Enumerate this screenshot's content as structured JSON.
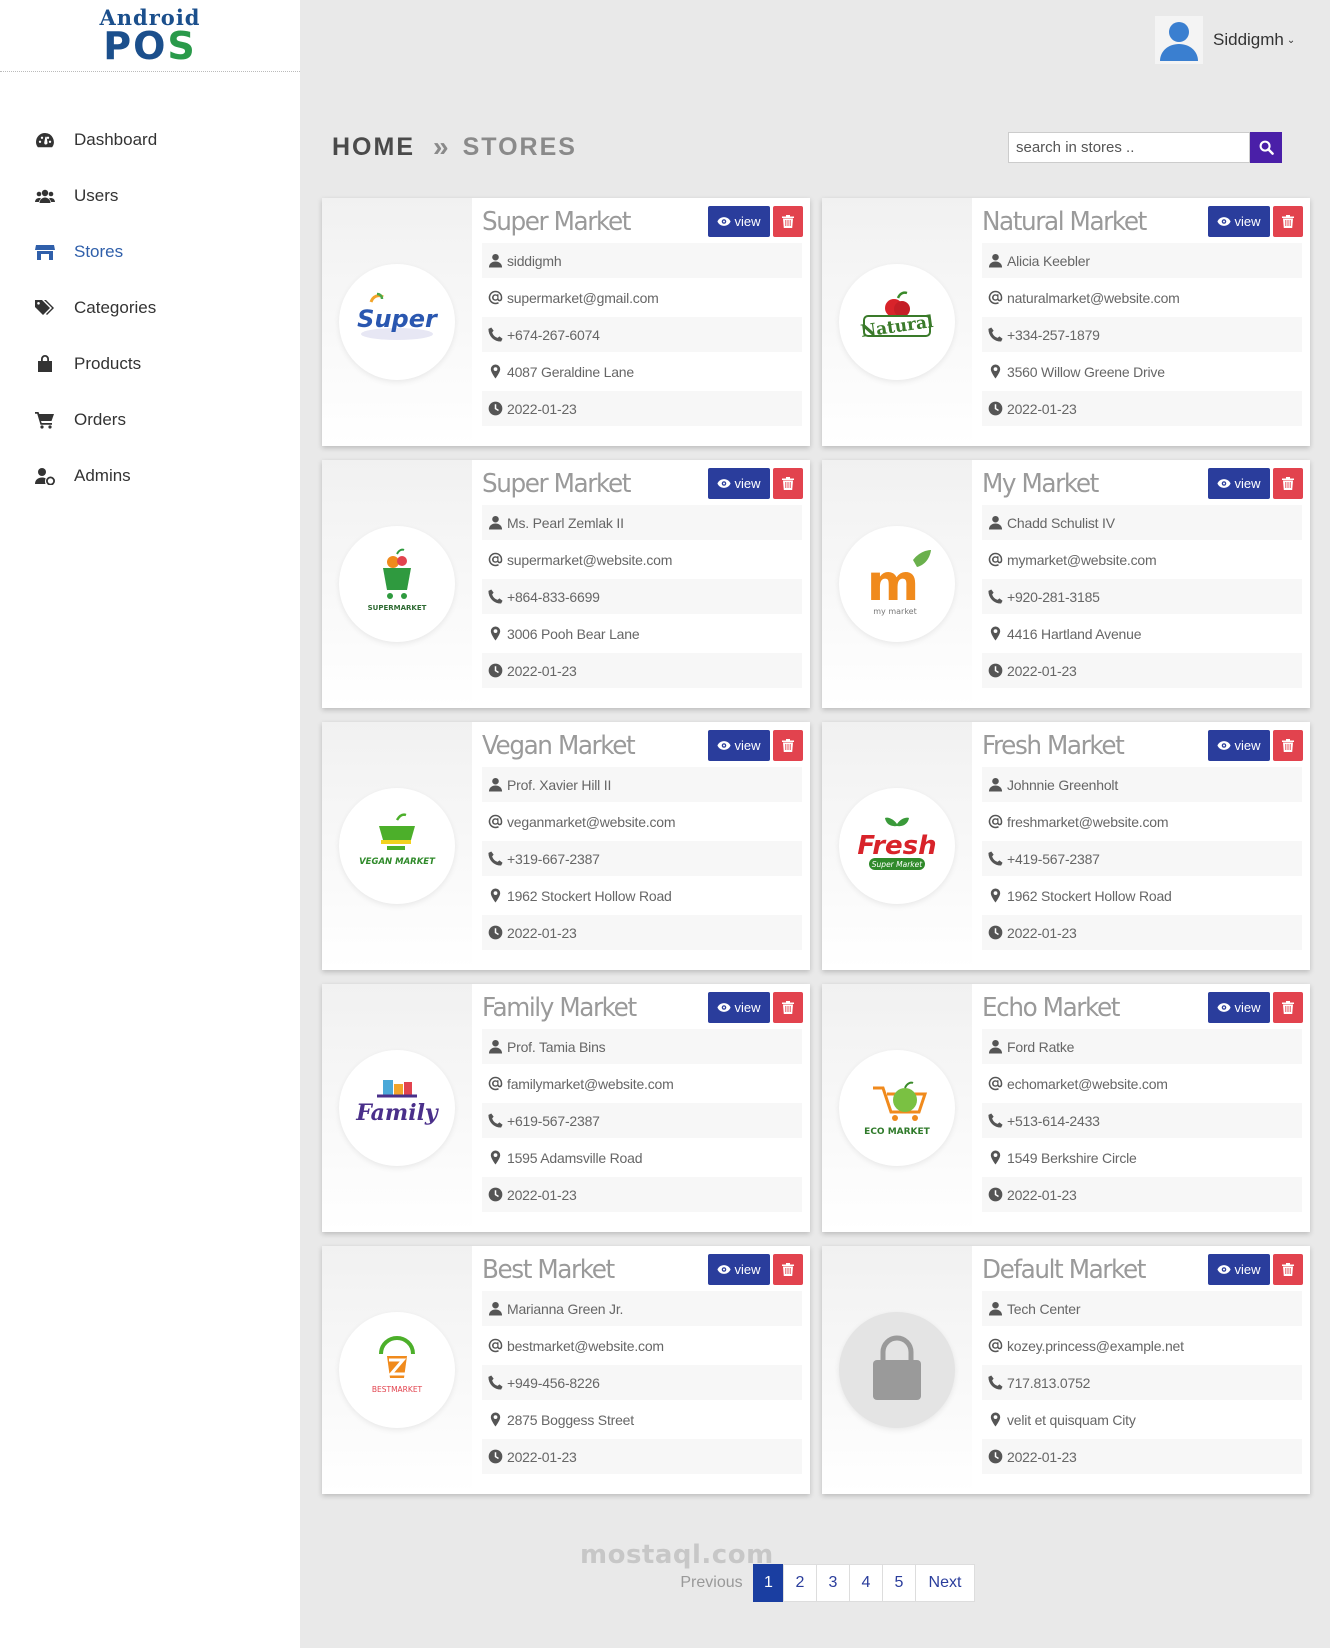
{
  "app": {
    "logo_top": "Android",
    "logo_bottom_a": "PO",
    "logo_bottom_b": "S",
    "user": "Siddigmh"
  },
  "sidebar": {
    "items": [
      {
        "label": "Dashboard",
        "icon": "dashboard-icon"
      },
      {
        "label": "Users",
        "icon": "users-icon"
      },
      {
        "label": "Stores",
        "icon": "store-icon"
      },
      {
        "label": "Categories",
        "icon": "tags-icon"
      },
      {
        "label": "Products",
        "icon": "bag-icon"
      },
      {
        "label": "Orders",
        "icon": "cart-icon"
      },
      {
        "label": "Admins",
        "icon": "admin-icon"
      }
    ],
    "active": "Stores"
  },
  "breadcrumb": {
    "home": "HOME",
    "separator": "»",
    "current": "STORES"
  },
  "search": {
    "placeholder": "search in stores ..",
    "value": ""
  },
  "buttons": {
    "view": "view"
  },
  "stores": [
    {
      "name": "Super Market",
      "owner": "siddigmh",
      "email": "supermarket@gmail.com",
      "phone": "+674-267-6074",
      "address": "4087 Geraldine Lane",
      "date": "2022-01-23",
      "logo": "super-market-logo"
    },
    {
      "name": "Natural Market",
      "owner": "Alicia Keebler",
      "email": "naturalmarket@website.com",
      "phone": "+334-257-1879",
      "address": "3560 Willow Greene Drive",
      "date": "2022-01-23",
      "logo": "natural-market-logo"
    },
    {
      "name": "Super Market",
      "owner": "Ms. Pearl Zemlak II",
      "email": "supermarket@website.com",
      "phone": "+864-833-6699",
      "address": "3006 Pooh Bear Lane",
      "date": "2022-01-23",
      "logo": "supermarket-basket-logo"
    },
    {
      "name": "My Market",
      "owner": "Chadd Schulist IV",
      "email": "mymarket@website.com",
      "phone": "+920-281-3185",
      "address": "4416 Hartland Avenue",
      "date": "2022-01-23",
      "logo": "my-market-logo"
    },
    {
      "name": "Vegan Market",
      "owner": "Prof. Xavier Hill II",
      "email": "veganmarket@website.com",
      "phone": "+319-667-2387",
      "address": "1962 Stockert Hollow Road",
      "date": "2022-01-23",
      "logo": "vegan-market-logo"
    },
    {
      "name": "Fresh Market",
      "owner": "Johnnie Greenholt",
      "email": "freshmarket@website.com",
      "phone": "+419-567-2387",
      "address": "1962 Stockert Hollow Road",
      "date": "2022-01-23",
      "logo": "fresh-market-logo"
    },
    {
      "name": "Family Market",
      "owner": "Prof. Tamia Bins",
      "email": "familymarket@website.com",
      "phone": "+619-567-2387",
      "address": "1595 Adamsville Road",
      "date": "2022-01-23",
      "logo": "family-market-logo"
    },
    {
      "name": "Echo Market",
      "owner": "Ford Ratke",
      "email": "echomarket@website.com",
      "phone": "+513-614-2433",
      "address": "1549 Berkshire Circle",
      "date": "2022-01-23",
      "logo": "eco-market-logo"
    },
    {
      "name": "Best Market",
      "owner": "Marianna Green Jr.",
      "email": "bestmarket@website.com",
      "phone": "+949-456-8226",
      "address": "2875 Boggess Street",
      "date": "2022-01-23",
      "logo": "best-market-logo"
    },
    {
      "name": "Default Market",
      "owner": "Tech Center",
      "email": "kozey.princess@example.net",
      "phone": "717.813.0752",
      "address": "velit et quisquam City",
      "date": "2022-01-23",
      "logo": "default-bag-logo"
    }
  ],
  "logo_text": {
    "super": "Super",
    "natural": "Natural",
    "supermarket": "SUPERMARKET",
    "my": "m",
    "my_sub": "my market",
    "vegan": "VEGAN MARKET",
    "fresh": "Fresh",
    "fresh_sub": "Super Market",
    "family": "Family",
    "eco": "ECO MARKET",
    "best": "BESTMARKET"
  },
  "pagination": {
    "previous": "Previous",
    "pages": [
      "1",
      "2",
      "3",
      "4",
      "5"
    ],
    "current": "1",
    "next": "Next"
  },
  "watermark": "mostaql.com",
  "colors": {
    "primary": "#2a3d9c",
    "danger": "#e2434e",
    "search": "#4a1fa8",
    "active_nav": "#2f5faa"
  }
}
